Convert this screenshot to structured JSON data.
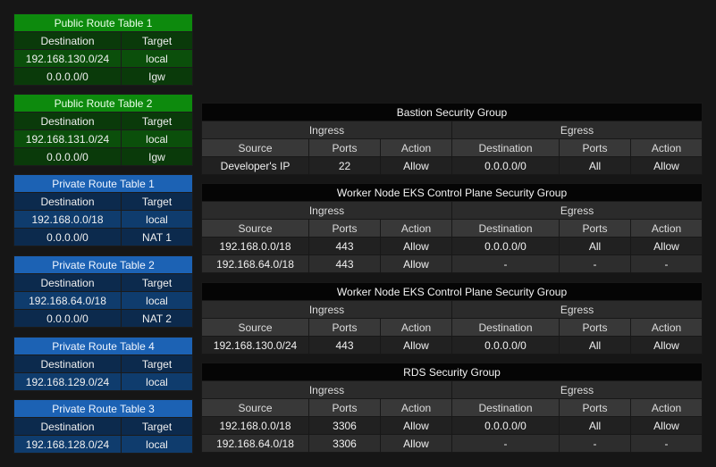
{
  "route_tables": [
    {
      "title": "Public Route Table 1",
      "kind": "public",
      "headers": [
        "Destination",
        "Target"
      ],
      "rows": [
        [
          "192.168.130.0/24",
          "local"
        ],
        [
          "0.0.0.0/0",
          "Igw"
        ]
      ]
    },
    {
      "title": "Public Route Table 2",
      "kind": "public",
      "headers": [
        "Destination",
        "Target"
      ],
      "rows": [
        [
          "192.168.131.0/24",
          "local"
        ],
        [
          "0.0.0.0/0",
          "Igw"
        ]
      ]
    },
    {
      "title": "Private Route Table 1",
      "kind": "private",
      "headers": [
        "Destination",
        "Target"
      ],
      "rows": [
        [
          "192.168.0.0/18",
          "local"
        ],
        [
          "0.0.0.0/0",
          "NAT 1"
        ]
      ]
    },
    {
      "title": "Private Route Table 2",
      "kind": "private",
      "headers": [
        "Destination",
        "Target"
      ],
      "rows": [
        [
          "192.168.64.0/18",
          "local"
        ],
        [
          "0.0.0.0/0",
          "NAT 2"
        ]
      ]
    },
    {
      "title": "Private Route Table 4",
      "kind": "private",
      "headers": [
        "Destination",
        "Target"
      ],
      "rows": [
        [
          "192.168.129.0/24",
          "local"
        ]
      ]
    },
    {
      "title": "Private Route Table 3",
      "kind": "private",
      "headers": [
        "Destination",
        "Target"
      ],
      "rows": [
        [
          "192.168.128.0/24",
          "local"
        ]
      ]
    }
  ],
  "security_groups": [
    {
      "title": "Bastion Security Group",
      "ingress_label": "Ingress",
      "egress_label": "Egress",
      "headers": [
        "Source",
        "Ports",
        "Action",
        "Destination",
        "Ports",
        "Action"
      ],
      "rows": [
        [
          "Developer's IP",
          "22",
          "Allow",
          "0.0.0.0/0",
          "All",
          "Allow"
        ]
      ]
    },
    {
      "title": "Worker Node EKS Control Plane Security Group",
      "ingress_label": "Ingress",
      "egress_label": "Egress",
      "headers": [
        "Source",
        "Ports",
        "Action",
        "Destination",
        "Ports",
        "Action"
      ],
      "rows": [
        [
          "192.168.0.0/18",
          "443",
          "Allow",
          "0.0.0.0/0",
          "All",
          "Allow"
        ],
        [
          "192.168.64.0/18",
          "443",
          "Allow",
          "-",
          "-",
          "-"
        ]
      ]
    },
    {
      "title": "Worker Node EKS Control Plane Security Group",
      "ingress_label": "Ingress",
      "egress_label": "Egress",
      "headers": [
        "Source",
        "Ports",
        "Action",
        "Destination",
        "Ports",
        "Action"
      ],
      "rows": [
        [
          "192.168.130.0/24",
          "443",
          "Allow",
          "0.0.0.0/0",
          "All",
          "Allow"
        ]
      ]
    },
    {
      "title": "RDS Security Group",
      "ingress_label": "Ingress",
      "egress_label": "Egress",
      "headers": [
        "Source",
        "Ports",
        "Action",
        "Destination",
        "Ports",
        "Action"
      ],
      "rows": [
        [
          "192.168.0.0/18",
          "3306",
          "Allow",
          "0.0.0.0/0",
          "All",
          "Allow"
        ],
        [
          "192.168.64.0/18",
          "3306",
          "Allow",
          "-",
          "-",
          "-"
        ]
      ]
    }
  ]
}
